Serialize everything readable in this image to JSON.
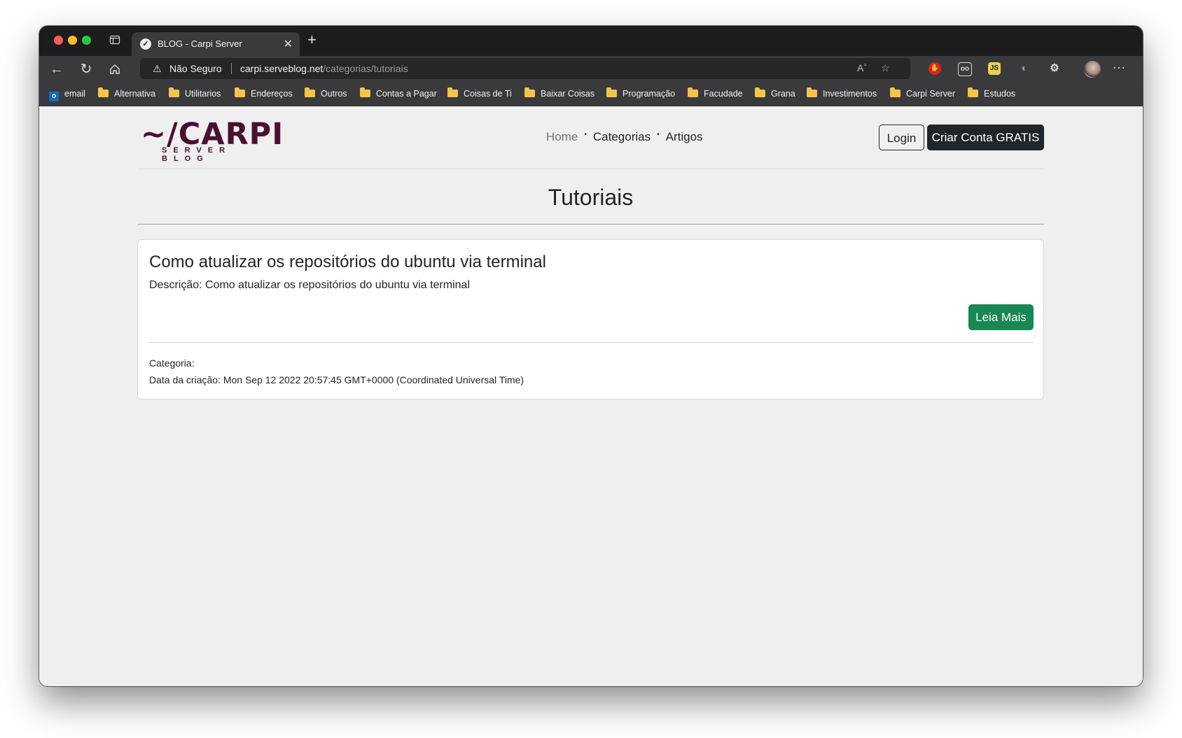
{
  "browser": {
    "tab_title": "BLOG - Carpi Server",
    "address": {
      "security_label": "Não Seguro",
      "host": "carpi.serveblog.net",
      "path": "/categorias/tutoriais"
    },
    "bookmarks": [
      {
        "label": "email",
        "icon": "outlook-icon"
      },
      {
        "label": "Alternativa",
        "icon": "folder-icon"
      },
      {
        "label": "Utilitarios",
        "icon": "folder-icon"
      },
      {
        "label": "Endereços",
        "icon": "folder-icon"
      },
      {
        "label": "Outros",
        "icon": "folder-icon"
      },
      {
        "label": "Contas a Pagar",
        "icon": "folder-icon"
      },
      {
        "label": "Coisas de Ti",
        "icon": "folder-icon"
      },
      {
        "label": "Baixar Coisas",
        "icon": "folder-icon"
      },
      {
        "label": "Programação",
        "icon": "folder-icon"
      },
      {
        "label": "Facudade",
        "icon": "folder-icon"
      },
      {
        "label": "Grana",
        "icon": "folder-icon"
      },
      {
        "label": "Investimentos",
        "icon": "folder-icon"
      },
      {
        "label": "Carpi Server",
        "icon": "folder-icon"
      },
      {
        "label": "Estudos",
        "icon": "folder-icon"
      }
    ]
  },
  "site": {
    "logo_text": "~/CARPI",
    "logo_subtitle": "SERVER BLOG",
    "nav": {
      "home": "Home",
      "categories": "Categorias",
      "articles": "Artigos"
    },
    "login_label": "Login",
    "signup_label": "Criar Conta GRATIS",
    "brand_color": "#4a1030"
  },
  "main": {
    "heading": "Tutoriais",
    "posts": [
      {
        "title": "Como atualizar os repositórios do ubuntu via terminal",
        "description": "Descrição: Como atualizar os repositórios do ubuntu via terminal",
        "read_more_label": "Leia Mais",
        "category": "Categoria:",
        "created": "Data da criação: Mon Sep 12 2022 20:57:45 GMT+0000 (Coordinated Universal Time)"
      }
    ]
  }
}
